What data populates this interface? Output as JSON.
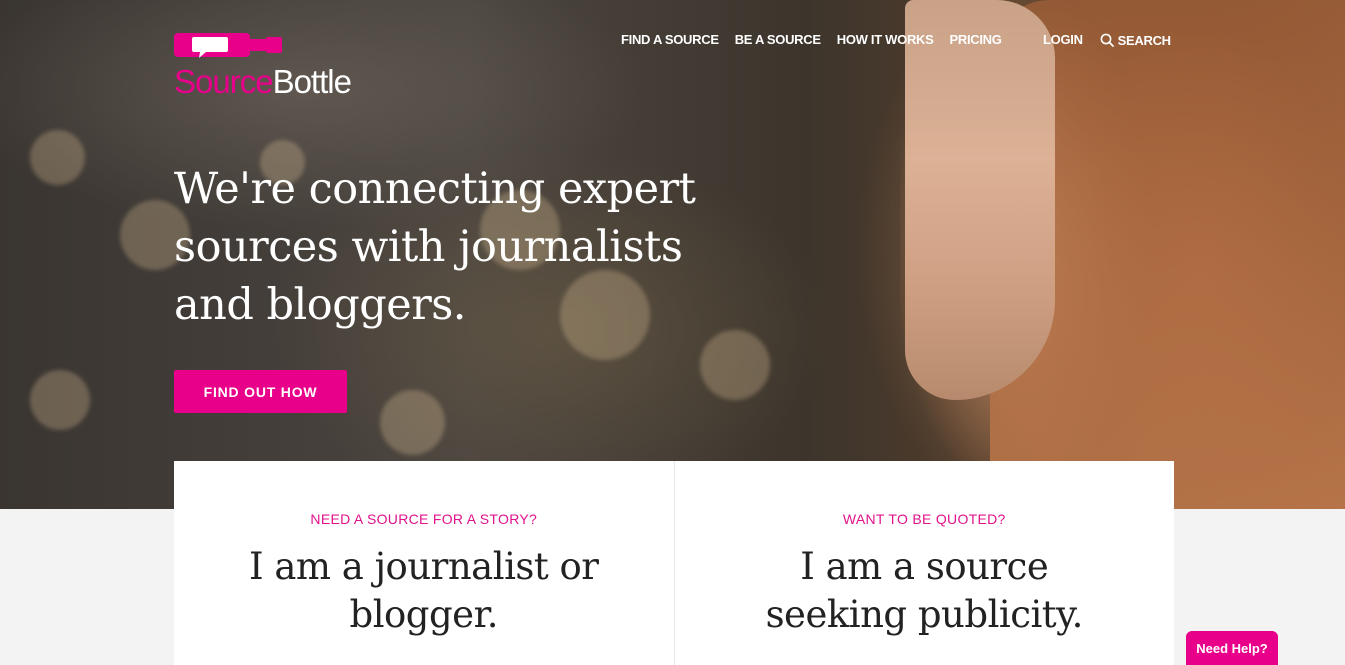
{
  "brand": {
    "name_part1": "Source",
    "name_part2": "Bottle",
    "accent_color": "#e8008a",
    "icon": "bottle-speech-bubble-icon"
  },
  "nav": {
    "main": [
      {
        "label": "FIND A SOURCE"
      },
      {
        "label": "BE A SOURCE"
      },
      {
        "label": "HOW IT WORKS"
      },
      {
        "label": "PRICING"
      }
    ],
    "login_label": "LOGIN",
    "search_label": "SEARCH",
    "search_icon": "search-icon"
  },
  "hero": {
    "headline": "We're connecting expert sources with journalists and bloggers.",
    "cta_label": "FIND OUT HOW"
  },
  "cards": [
    {
      "kicker": "NEED A SOURCE FOR A STORY?",
      "title": "I am a journalist or blogger."
    },
    {
      "kicker": "WANT TO BE QUOTED?",
      "title": "I am a source seeking publicity."
    }
  ],
  "help": {
    "label": "Need Help?"
  }
}
